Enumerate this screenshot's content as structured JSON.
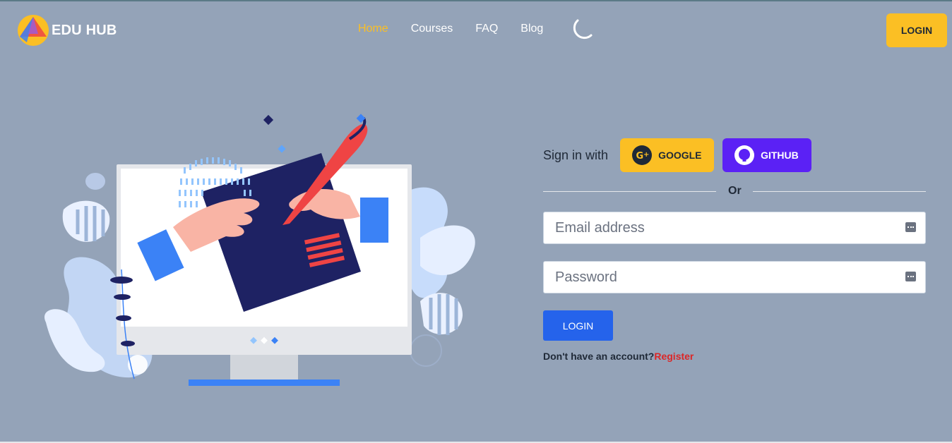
{
  "brand": {
    "name": "EDU HUB"
  },
  "nav": {
    "items": [
      {
        "label": "Home",
        "active": true
      },
      {
        "label": "Courses",
        "active": false
      },
      {
        "label": "FAQ",
        "active": false
      },
      {
        "label": "Blog",
        "active": false
      }
    ],
    "theme_icon": "moon-icon",
    "login_label": "LOGIN"
  },
  "signin": {
    "label": "Sign in with",
    "google_label": "GOOGLE",
    "github_label": "GITHUB",
    "divider_text": "Or"
  },
  "form": {
    "email_placeholder": "Email address",
    "password_placeholder": "Password",
    "submit_label": "LOGIN",
    "no_account_text": "Don't have an account?",
    "register_label": "Register"
  },
  "colors": {
    "background": "#94a3b8",
    "accent_yellow": "#fbbf24",
    "github_purple": "#5b21f5",
    "primary_blue": "#2563eb",
    "register_red": "#dc2626"
  }
}
